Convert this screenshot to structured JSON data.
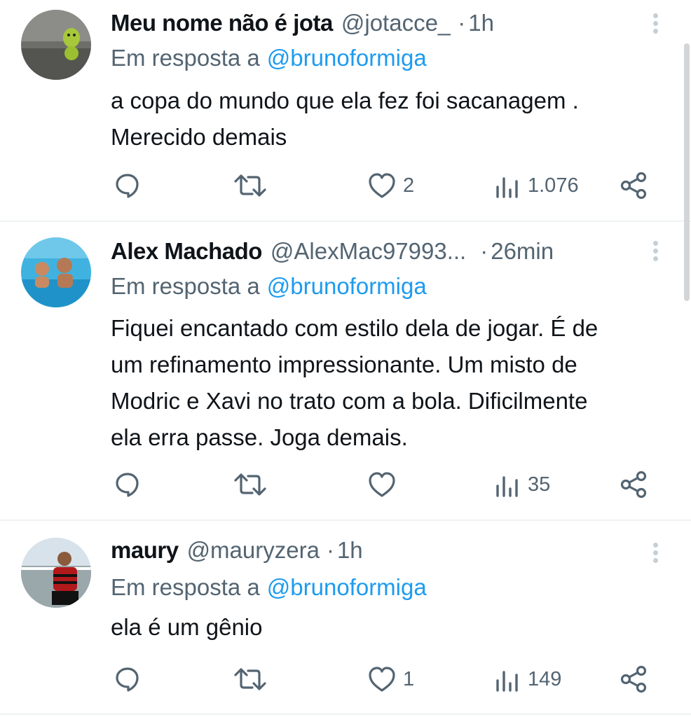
{
  "reply_prefix": "Em resposta a",
  "tweets": [
    {
      "name": "Meu nome não é jota",
      "handle": "@jotacce_",
      "dot": "·",
      "time": "1h",
      "reply_to": "@brunoformiga",
      "text_lines": [
        "a copa do mundo que ela fez foi sacanagem .",
        "Merecido demais"
      ],
      "likes": "2",
      "views": "1.076"
    },
    {
      "name": "Alex Machado",
      "handle": "@AlexMac97993...",
      "dot": "·",
      "time": "26min",
      "reply_to": "@brunoformiga",
      "text_lines": [
        "Fiquei encantado com estilo dela de jogar. É de",
        "um refinamento impressionante. Um misto de",
        "Modric e Xavi no trato com a bola. Dificilmente",
        "ela erra passe. Joga demais."
      ],
      "likes": "",
      "views": "35"
    },
    {
      "name": "maury",
      "handle": "@mauryzera",
      "dot": "·",
      "time": "1h",
      "reply_to": "@brunoformiga",
      "text_lines": [
        "ela é um gênio"
      ],
      "likes": "1",
      "views": "149"
    }
  ],
  "colors": {
    "text": "#0f1419",
    "secondary": "#536471",
    "link": "#1d9bf0",
    "divider": "#eff3f4"
  },
  "icons": [
    "reply-icon",
    "retweet-icon",
    "like-icon",
    "views-icon",
    "share-icon",
    "more-icon"
  ]
}
